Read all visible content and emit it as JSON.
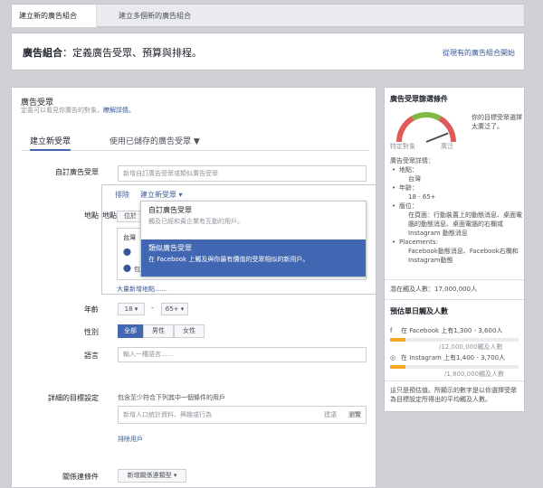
{
  "tabs": {
    "create_new": "建立新的廣告組合",
    "create_multiple": "建立多個新的廣告組合"
  },
  "header": {
    "label": "廣告組合",
    "subtitle": "：定義廣告受眾、預算與排程。",
    "link_existing": "從現有的廣告組合開始"
  },
  "audience": {
    "title": "廣告受眾",
    "subtitle_prefix": "定義可以看見你廣告的對象。",
    "learn_more": "瞭解詳情。",
    "tab_create": "建立新受眾",
    "tab_saved": "使用已儲存的廣告受眾",
    "custom_label": "自訂廣告受眾",
    "custom_placeholder": "新增自訂廣告受眾或類似廣告受眾",
    "exclude": "排除",
    "create_new": "建立新受眾",
    "location_label": "地點",
    "location_select": "位於",
    "location_value": "台灣",
    "location_include": "包",
    "bulk_add": "大量新增地點……",
    "age_label": "年齡",
    "age_min": "18",
    "age_dash": "-",
    "age_max": "65+",
    "gender_label": "性別",
    "gender_all": "全部",
    "gender_male": "男性",
    "gender_female": "女性",
    "language_label": "語言",
    "language_placeholder": "輸入一種語言……",
    "detailed_label": "詳細的目標設定",
    "detailed_desc": "包含至少符合下列其中一個條件的用戶",
    "detailed_placeholder": "新增人口統計資料、興趣或行為",
    "suggestions": "建議",
    "browse": "瀏覽",
    "exclude_users": "排除用戶",
    "connections_label": "關係連條件",
    "connections_select": "新增關係連類型"
  },
  "dropdown": {
    "items": [
      {
        "title": "自訂廣告受眾",
        "desc": "觸及已經和貴企業有互動的用戶。"
      },
      {
        "title": "類似廣告受眾",
        "desc": "在 Facebook 上觸及與你最有價值的受眾相似的新用戶。"
      }
    ]
  },
  "side": {
    "definition_title": "廣告受眾篩選條件",
    "gauge_specific": "特定對象",
    "gauge_broad": "廣泛",
    "gauge_desc": "你的目標受眾選擇太廣泛了。",
    "details_title": "廣告受眾詳情：",
    "details": [
      {
        "label": "地點：",
        "sub": [
          "台灣"
        ]
      },
      {
        "label": "年齡：",
        "sub": [
          "18 - 65+"
        ]
      },
      {
        "label": "版位：",
        "sub": [
          "在頁面：行動裝置上的動態消息、桌面電腦的動態消息、桌面電腦的右欄或 Instagram 動態消息"
        ]
      },
      {
        "label": "Placements:",
        "sub": [
          "Facebook動態消息、Facebook右欄和Instagram動態"
        ]
      }
    ],
    "potential_reach": "潛在觸及人數：17,000,000人",
    "estimate_title": "預估單日觸及人數",
    "fb_label": "在 Facebook 上有1,300 - 3,600人",
    "fb_total": "/12,000,000觸及人數",
    "ig_label": "在 Instagram 上有1,400 - 3,700人",
    "ig_total": "/1,800,000觸及人數",
    "note": "這只是預估值。所顯示的數字是以你選擇受眾為目標設定所得出的平均觸及人數。",
    "gauge_level": 0.88
  },
  "colors": {
    "accent": "#4267b2",
    "bg": "#d0d1d4",
    "bar": "#f5a623"
  }
}
